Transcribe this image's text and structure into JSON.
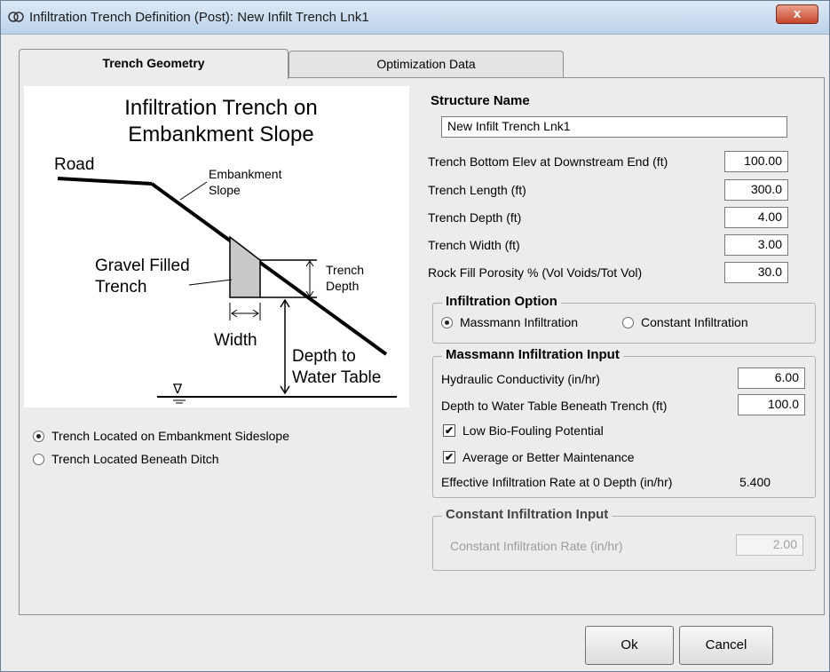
{
  "window": {
    "title": "Infiltration Trench Definition (Post): New Infilt Trench Lnk1",
    "close_label": "x"
  },
  "tabs": [
    {
      "label": "Trench Geometry",
      "active": true
    },
    {
      "label": "Optimization Data",
      "active": false
    }
  ],
  "diagram": {
    "title_line1": "Infiltration Trench on",
    "title_line2": "Embankment Slope",
    "road": "Road",
    "embankment_line1": "Embankment",
    "embankment_line2": "Slope",
    "gravel_line1": "Gravel Filled",
    "gravel_line2": "Trench",
    "trench_depth_line1": "Trench",
    "trench_depth_line2": "Depth",
    "width": "Width",
    "water_line1": "Depth to",
    "water_line2": "Water Table",
    "water_symbol": "∇"
  },
  "location_options": [
    {
      "label": "Trench Located on Embankment Sideslope",
      "selected": true
    },
    {
      "label": "Trench Located Beneath Ditch",
      "selected": false
    }
  ],
  "structure": {
    "name_label": "Structure Name",
    "name_value": "New Infilt Trench Lnk1"
  },
  "fields": [
    {
      "label": "Trench Bottom Elev at Downstream  End (ft)",
      "value": "100.00"
    },
    {
      "label": "Trench Length (ft)",
      "value": "300.0"
    },
    {
      "label": "Trench Depth (ft)",
      "value": "4.00"
    },
    {
      "label": "Trench Width (ft)",
      "value": "3.00"
    },
    {
      "label": "Rock Fill Porosity % (Vol Voids/Tot Vol)",
      "value": "30.0"
    }
  ],
  "infiltration_option": {
    "title": "Infiltration Option",
    "options": [
      {
        "label": "Massmann Infiltration",
        "selected": true
      },
      {
        "label": "Constant Infiltration",
        "selected": false
      }
    ]
  },
  "massmann": {
    "title": "Massmann Infiltration Input",
    "hydraulic_label": "Hydraulic Conductivity (in/hr)",
    "hydraulic_value": "6.00",
    "depth_label": "Depth to Water Table Beneath Trench (ft)",
    "depth_value": "100.0",
    "biofouling_label": "Low Bio-Fouling Potential",
    "biofouling_checked": true,
    "maintenance_label": "Average or Better Maintenance",
    "maintenance_checked": true,
    "effective_label": "Effective Infiltration Rate at 0 Depth (in/hr)",
    "effective_value": "5.400",
    "check_mark": "✔"
  },
  "constant": {
    "title": "Constant Infiltration Input",
    "rate_label": "Constant Infiltration Rate (in/hr)",
    "rate_value": "2.00"
  },
  "buttons": {
    "ok": "Ok",
    "cancel": "Cancel"
  }
}
